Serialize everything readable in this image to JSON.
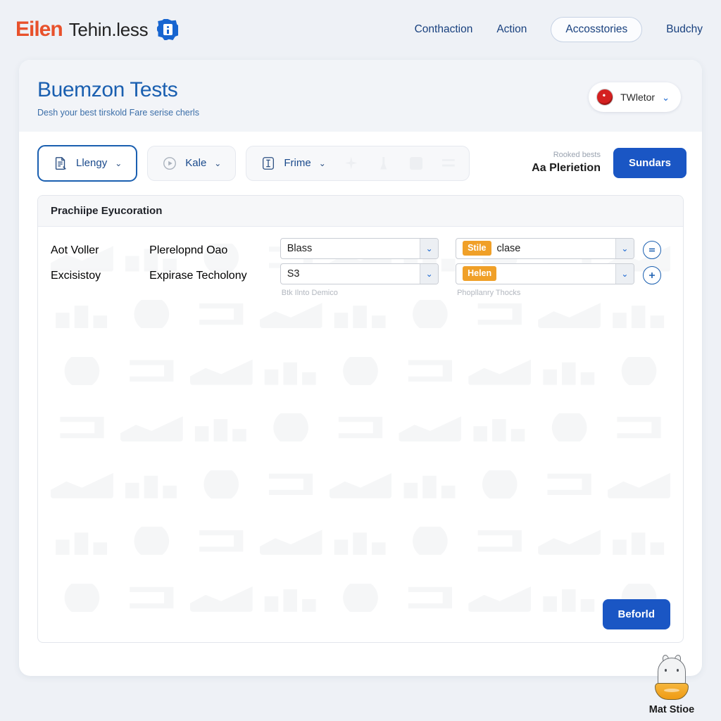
{
  "brand": {
    "mark": "Eilen",
    "word": "Tehin.less",
    "badge_icon": "clipboard-badge-icon",
    "accent_orange": "#e8512b",
    "accent_blue": "#1765d0"
  },
  "nav": {
    "items": [
      {
        "label": "Conthaction",
        "pill": false
      },
      {
        "label": "Action",
        "pill": false
      },
      {
        "label": "Accosstories",
        "pill": true
      },
      {
        "label": "Budchy",
        "pill": false
      }
    ]
  },
  "header": {
    "title": "Buemzon Tests",
    "subtitle": "Desh your best tirskold Fare serise cherls",
    "user": {
      "name": "TWletor",
      "chevron": "⌄"
    }
  },
  "toolbar": {
    "segments": [
      {
        "label": "Llengy",
        "icon": "document-pen-icon",
        "active": true
      },
      {
        "label": "Kale",
        "icon": "play-circle-icon",
        "active": false
      },
      {
        "label": "Frime",
        "icon": "framed-square-icon",
        "active": false
      }
    ],
    "ghost_icons": [
      "sparkle-icon",
      "pin-icon",
      "building-icon",
      "scissors-icon"
    ],
    "stat_label": "Rooked bests",
    "stat_value": "Aa Plerietion",
    "primary_button": "Sundars",
    "chevron": "⌄"
  },
  "panel": {
    "title": "Prachiipe Eyucoration",
    "rows": [
      {
        "label_a": "Aot Voller",
        "label_b": "Plerelopnd Oao",
        "select_left": {
          "value": "Blass",
          "hint": ""
        },
        "select_right": {
          "badge": "Stile",
          "value": "clase",
          "hint": ""
        },
        "action_icon": "equals-circle-icon"
      },
      {
        "label_a": "Excisistoy",
        "label_b": "Expirase Techolony",
        "select_left": {
          "value": "S3",
          "hint": "Btk Ilnto Demico"
        },
        "select_right": {
          "badge": "Helen",
          "value": "",
          "hint": "Phopllanry Thocks"
        },
        "action_icon": "plus-circle-icon"
      }
    ],
    "submit_button": "Beforld",
    "dropdown_arrow": "⌄"
  },
  "mascot": {
    "label": "Mat Stioe",
    "icon": "mascot-figure-icon"
  }
}
